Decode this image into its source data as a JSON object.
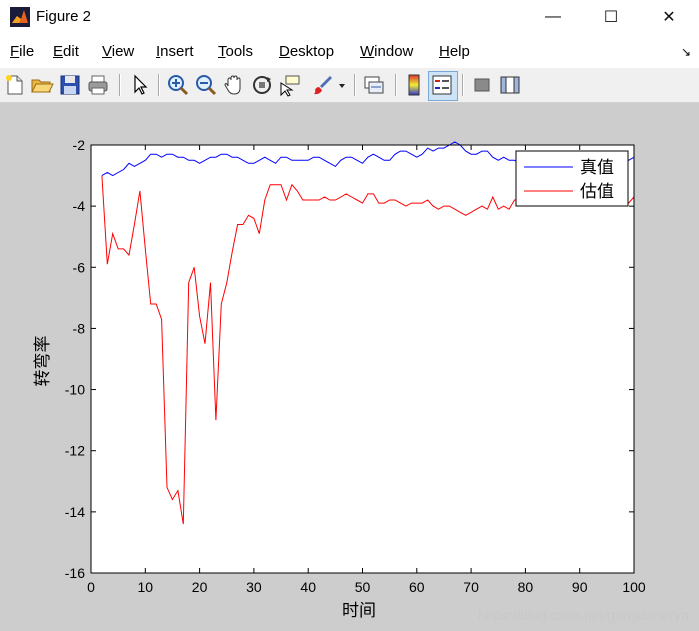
{
  "window": {
    "title": "Figure 2",
    "minimize_glyph": "—",
    "maximize_glyph": "☐",
    "close_glyph": "✕"
  },
  "menu": {
    "items": [
      "File",
      "Edit",
      "View",
      "Insert",
      "Tools",
      "Desktop",
      "Window",
      "Help"
    ],
    "corner_glyph": "↘"
  },
  "toolbar": {
    "icons": [
      "new-figure-icon",
      "open-file-icon",
      "save-icon",
      "print-icon",
      "edit-plot-icon",
      "zoom-in-icon",
      "zoom-out-icon",
      "pan-icon",
      "rotate-3d-icon",
      "data-cursor-icon",
      "brush-icon",
      "link-plot-icon",
      "colorbar-icon",
      "legend-icon",
      "hide-plot-tools-icon",
      "show-plot-tools-icon"
    ]
  },
  "watermark": "https://blog.csdn.net/gangdanerya",
  "colors": {
    "series_true": "#0000ff",
    "series_est": "#ff0000",
    "window_bg": "#cdcdcd",
    "axes_bg": "#ffffff"
  },
  "chart_data": {
    "type": "line",
    "title": "",
    "xlabel": "时间",
    "ylabel": "转弯率",
    "xlim": [
      0,
      100
    ],
    "ylim": [
      -16,
      -2
    ],
    "xticks": [
      0,
      10,
      20,
      30,
      40,
      50,
      60,
      70,
      80,
      90,
      100
    ],
    "yticks": [
      -2,
      -4,
      -6,
      -8,
      -10,
      -12,
      -14,
      -16
    ],
    "legend_position": "top-right",
    "series": [
      {
        "name": "真值",
        "color": "#0000ff",
        "x": [
          2,
          3,
          4,
          5,
          6,
          7,
          8,
          9,
          10,
          11,
          12,
          13,
          14,
          15,
          16,
          17,
          18,
          19,
          20,
          21,
          22,
          23,
          24,
          25,
          26,
          27,
          28,
          29,
          30,
          31,
          32,
          33,
          34,
          35,
          36,
          37,
          38,
          39,
          40,
          41,
          42,
          43,
          44,
          45,
          46,
          47,
          48,
          49,
          50,
          51,
          52,
          53,
          54,
          55,
          56,
          57,
          58,
          59,
          60,
          61,
          62,
          63,
          64,
          65,
          66,
          67,
          68,
          69,
          70,
          71,
          72,
          73,
          74,
          75,
          76,
          77,
          78,
          79,
          80,
          81,
          82,
          83,
          84,
          85,
          86,
          87,
          88,
          89,
          90,
          91,
          92,
          93,
          94,
          95,
          96,
          97,
          98,
          99,
          100
        ],
        "y": [
          -3.0,
          -2.9,
          -3.0,
          -2.9,
          -2.8,
          -2.6,
          -2.7,
          -2.6,
          -2.5,
          -2.3,
          -2.3,
          -2.4,
          -2.3,
          -2.3,
          -2.4,
          -2.4,
          -2.5,
          -2.5,
          -2.6,
          -2.5,
          -2.4,
          -2.4,
          -2.3,
          -2.3,
          -2.4,
          -2.4,
          -2.5,
          -2.6,
          -2.6,
          -2.5,
          -2.4,
          -2.5,
          -2.6,
          -2.4,
          -2.4,
          -2.5,
          -2.5,
          -2.5,
          -2.5,
          -2.4,
          -2.4,
          -2.5,
          -2.6,
          -2.7,
          -2.5,
          -2.4,
          -2.4,
          -2.5,
          -2.6,
          -2.4,
          -2.3,
          -2.4,
          -2.5,
          -2.5,
          -2.3,
          -2.2,
          -2.2,
          -2.3,
          -2.4,
          -2.3,
          -2.1,
          -2.2,
          -2.1,
          -2.1,
          -2.0,
          -1.9,
          -2.0,
          -2.2,
          -2.3,
          -2.3,
          -2.2,
          -2.2,
          -2.4,
          -2.5,
          -2.4,
          -2.5,
          -2.5,
          -2.6,
          -2.6,
          -2.5,
          -2.5,
          -2.4,
          -2.5,
          -2.6,
          -2.5,
          -2.5,
          -2.4,
          -2.5,
          -2.3,
          -2.2,
          -2.4,
          -2.3,
          -2.5,
          -2.4,
          -2.4,
          -2.5,
          -2.6,
          -2.5,
          -2.4
        ]
      },
      {
        "name": "估值",
        "color": "#ff0000",
        "x": [
          2,
          3,
          4,
          5,
          6,
          7,
          8,
          9,
          10,
          11,
          12,
          13,
          14,
          15,
          16,
          17,
          18,
          19,
          20,
          21,
          22,
          23,
          24,
          25,
          26,
          27,
          28,
          29,
          30,
          31,
          32,
          33,
          34,
          35,
          36,
          37,
          38,
          39,
          40,
          41,
          42,
          43,
          44,
          45,
          46,
          47,
          48,
          49,
          50,
          51,
          52,
          53,
          54,
          55,
          56,
          57,
          58,
          59,
          60,
          61,
          62,
          63,
          64,
          65,
          66,
          67,
          68,
          69,
          70,
          71,
          72,
          73,
          74,
          75,
          76,
          77,
          78,
          79,
          80,
          81,
          82,
          83,
          84,
          85,
          86,
          87,
          88,
          89,
          90,
          91,
          92,
          93,
          94,
          95,
          96,
          97,
          98,
          99,
          100
        ],
        "y": [
          -3.0,
          -5.9,
          -4.9,
          -5.4,
          -5.4,
          -5.6,
          -4.6,
          -3.5,
          -5.4,
          -7.2,
          -7.2,
          -7.7,
          -13.2,
          -13.6,
          -13.3,
          -14.4,
          -6.5,
          -6.0,
          -7.6,
          -8.5,
          -6.5,
          -11.0,
          -7.2,
          -6.5,
          -5.5,
          -4.6,
          -4.6,
          -4.3,
          -4.4,
          -4.9,
          -3.8,
          -3.3,
          -3.3,
          -3.3,
          -3.8,
          -3.3,
          -3.5,
          -3.8,
          -3.8,
          -3.8,
          -3.8,
          -3.7,
          -3.8,
          -3.8,
          -3.7,
          -3.6,
          -3.7,
          -3.8,
          -3.9,
          -3.6,
          -3.6,
          -3.9,
          -3.9,
          -3.8,
          -3.8,
          -3.9,
          -4.0,
          -3.9,
          -3.9,
          -3.9,
          -3.8,
          -4.0,
          -4.1,
          -4.0,
          -4.0,
          -4.1,
          -4.2,
          -4.3,
          -4.2,
          -4.1,
          -4.0,
          -4.1,
          -3.7,
          -4.1,
          -4.0,
          -4.1,
          -3.8,
          -3.8,
          -3.6,
          -3.7,
          -3.9,
          -3.8,
          -3.8,
          -3.9,
          -3.8,
          -3.7,
          -3.8,
          -3.8,
          -3.9,
          -3.8,
          -3.8,
          -3.8,
          -3.9,
          -3.7,
          -3.8,
          -3.8,
          -3.9,
          -3.9,
          -3.7
        ]
      }
    ]
  }
}
